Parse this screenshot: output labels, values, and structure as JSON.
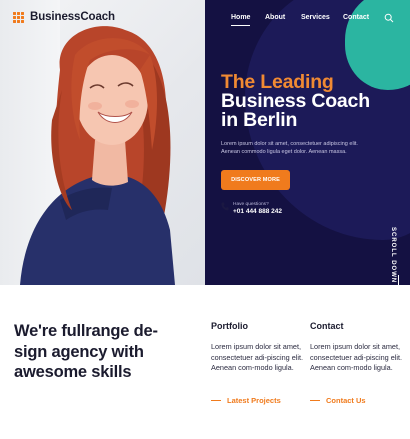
{
  "brand": {
    "name": "BusinessCoach",
    "accent": "#f07b1d",
    "navy": "#141142",
    "teal": "#2bb5a1"
  },
  "nav": {
    "items": [
      {
        "label": "Home",
        "active": true
      },
      {
        "label": "About",
        "active": false
      },
      {
        "label": "Services",
        "active": false
      },
      {
        "label": "Contact",
        "active": false
      }
    ],
    "search_icon": "search-icon"
  },
  "hero": {
    "title_line1": "The Leading",
    "title_line2": "Business Coach",
    "title_line3": "in Berlin",
    "description": "Lorem ipsum dolor sit amet, consectetuer adipiscing elit. Aenean commodo ligula eget dolor. Aenean massa.",
    "cta_label": "DISCOVER MORE",
    "phone_question": "Have questions?",
    "phone_number": "+01 444 888 242",
    "scroll_label": "SCROLL DOWN"
  },
  "intro": {
    "headline": "We're fullrange de-sign agency with awesome skills"
  },
  "columns": [
    {
      "title": "Portfolio",
      "text": "Lorem ipsum dolor sit amet, consectetuer adi-piscing elit. Aenean com-modo ligula.",
      "link": "Latest Projects"
    },
    {
      "title": "Contact",
      "text": "Lorem ipsum dolor sit amet, consectetuer adi-piscing elit. Aenean com-modo ligula.",
      "link": "Contact Us"
    }
  ]
}
